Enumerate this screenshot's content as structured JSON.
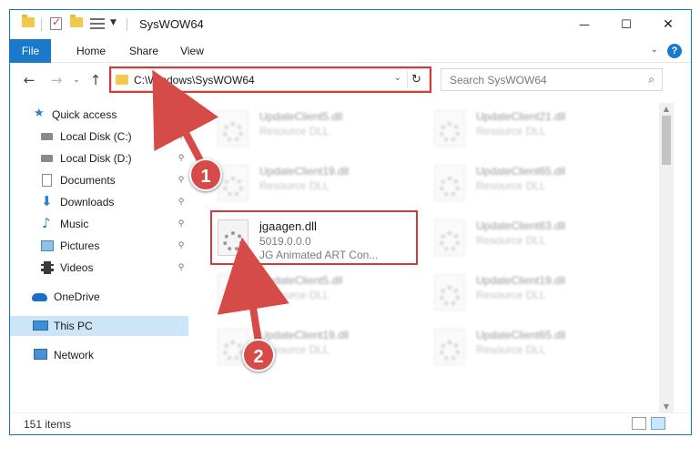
{
  "window": {
    "title": "SysWOW64",
    "minimize_glyph": "—",
    "maximize_glyph": "☐",
    "close_glyph": "✕"
  },
  "ribbon": {
    "tabs": [
      "File",
      "Home",
      "Share",
      "View"
    ],
    "help_glyph": "?"
  },
  "address_bar": {
    "path": "C:\\Windows\\SysWOW64",
    "search_placeholder": "Search SysWOW64"
  },
  "nav_pane": {
    "items": [
      {
        "label": "Quick access",
        "icon": "star-icon",
        "pinned": false
      },
      {
        "label": "Local Disk (C:)",
        "icon": "drive-icon",
        "pinned": true
      },
      {
        "label": "Local Disk (D:)",
        "icon": "drive-icon",
        "pinned": true
      },
      {
        "label": "Documents",
        "icon": "documents-icon",
        "pinned": true
      },
      {
        "label": "Downloads",
        "icon": "download-icon",
        "pinned": true
      },
      {
        "label": "Music",
        "icon": "music-icon",
        "pinned": true
      },
      {
        "label": "Pictures",
        "icon": "pictures-icon",
        "pinned": true
      },
      {
        "label": "Videos",
        "icon": "videos-icon",
        "pinned": true
      },
      {
        "label": "OneDrive",
        "icon": "cloud-icon",
        "pinned": false
      },
      {
        "label": "This PC",
        "icon": "computer-icon",
        "pinned": false,
        "selected": true
      },
      {
        "label": "Network",
        "icon": "network-icon",
        "pinned": false
      }
    ]
  },
  "files": {
    "left_column": [
      {
        "name": "UpdateClient5.dll",
        "desc": "Resource DLL"
      },
      {
        "name": "UpdateClient19.dll",
        "desc": "Resource DLL"
      },
      {
        "name": "jgaagen.dll",
        "desc": "5019.0.0.0",
        "desc2": "JG Animated ART Con...",
        "highlighted": true
      },
      {
        "name": "UpdateClient5.dll",
        "desc": "Resource DLL"
      },
      {
        "name": "UpdateClient19.dll",
        "desc": "Resource DLL"
      }
    ],
    "right_column": [
      {
        "name": "UpdateClient21.dll",
        "desc": "Resource DLL"
      },
      {
        "name": "UpdateClient65.dll",
        "desc": "Resource DLL"
      },
      {
        "name": "UpdateClient63.dll",
        "desc": "Resource DLL"
      },
      {
        "name": "UpdateClient19.dll",
        "desc": "Resource DLL"
      },
      {
        "name": "UpdateClient65.dll",
        "desc": "Resource DLL"
      }
    ]
  },
  "status": {
    "item_count": "151 items"
  },
  "annotations": {
    "step1": "1",
    "step2": "2",
    "color": "#d64a47"
  }
}
